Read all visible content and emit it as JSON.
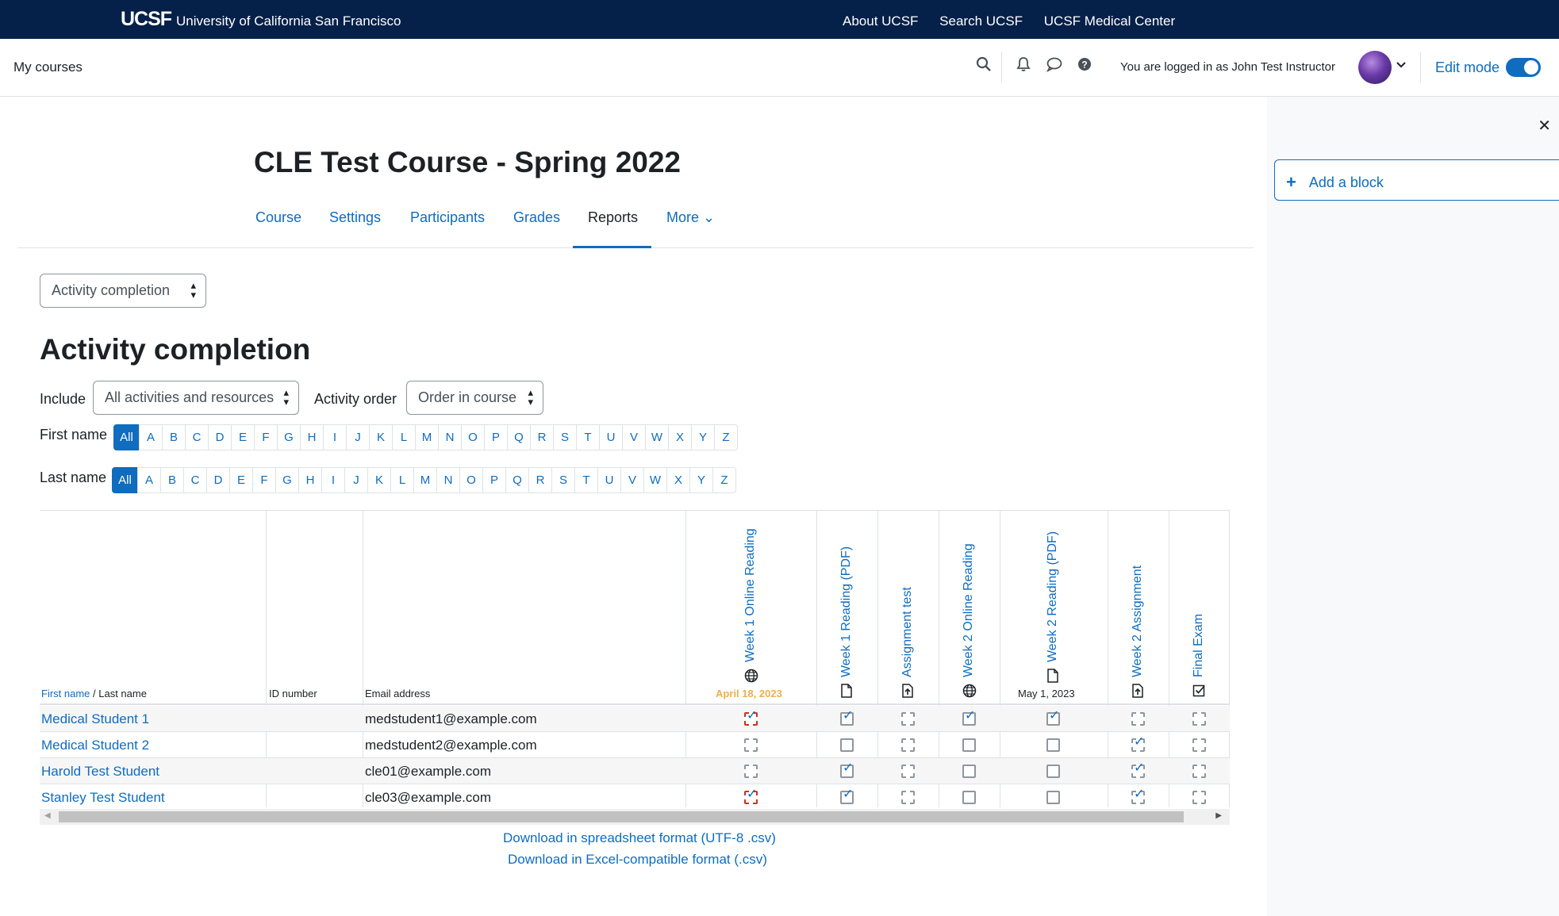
{
  "topbar": {
    "logo": "UCSF",
    "university": "University of California San Francisco",
    "links": [
      "About UCSF",
      "Search UCSF",
      "UCSF Medical Center"
    ]
  },
  "navbar": {
    "my_courses": "My courses",
    "logged_in": "You are logged in as John Test Instructor",
    "edit_mode": "Edit mode",
    "edit_mode_on": true
  },
  "drawer": {
    "add_block": "Add a block"
  },
  "course": {
    "title": "CLE Test Course - Spring 2022",
    "tabs": [
      {
        "label": "Course"
      },
      {
        "label": "Settings"
      },
      {
        "label": "Participants"
      },
      {
        "label": "Grades"
      },
      {
        "label": "Reports",
        "active": true
      },
      {
        "label": "More ⌄"
      }
    ]
  },
  "report_select": "Activity completion",
  "heading": "Activity completion",
  "filters": {
    "include_label": "Include",
    "include_value": "All activities and resources",
    "order_label": "Activity order",
    "order_value": "Order in course",
    "first_name_label": "First name",
    "last_name_label": "Last name",
    "letters": [
      "All",
      "A",
      "B",
      "C",
      "D",
      "E",
      "F",
      "G",
      "H",
      "I",
      "J",
      "K",
      "L",
      "M",
      "N",
      "O",
      "P",
      "Q",
      "R",
      "S",
      "T",
      "U",
      "V",
      "W",
      "X",
      "Y",
      "Z"
    ]
  },
  "table": {
    "col_firstname": "First name",
    "col_sep": " / ",
    "col_lastname": "Last name",
    "col_id": "ID number",
    "col_email": "Email address",
    "activities": [
      {
        "name": "Week 1 Online Reading",
        "icon": "globe-icon",
        "date": "April 18, 2023",
        "date_warn": true
      },
      {
        "name": "Week 1 Reading (PDF)",
        "icon": "file-icon",
        "date": ""
      },
      {
        "name": "Assignment test",
        "icon": "assignment-icon",
        "date": ""
      },
      {
        "name": "Week 2 Online Reading",
        "icon": "globe-icon",
        "date": ""
      },
      {
        "name": "Week 2 Reading (PDF)",
        "icon": "file-icon",
        "date": "May 1, 2023",
        "date_warn": false
      },
      {
        "name": "Week 2 Assignment",
        "icon": "assignment-icon",
        "date": ""
      },
      {
        "name": "Final Exam",
        "icon": "quiz-icon",
        "date": ""
      }
    ],
    "rows": [
      {
        "name": "Medical Student 1",
        "email": "medstudent1@example.com",
        "cells": [
          "checked-red",
          "checked",
          "empty-auto",
          "checked",
          "checked",
          "empty-auto",
          "empty-auto"
        ]
      },
      {
        "name": "Medical Student 2",
        "email": "medstudent2@example.com",
        "cells": [
          "empty-auto",
          "empty",
          "empty-auto",
          "empty",
          "empty",
          "checked-auto",
          "empty-auto"
        ]
      },
      {
        "name": "Harold Test Student",
        "email": "cle01@example.com",
        "cells": [
          "empty-auto",
          "checked",
          "empty-auto",
          "empty",
          "empty",
          "checked-auto",
          "empty-auto"
        ]
      },
      {
        "name": "Stanley Test Student",
        "email": "cle03@example.com",
        "cells": [
          "checked-red",
          "checked",
          "empty-auto",
          "empty",
          "empty",
          "checked-auto",
          "empty-auto"
        ]
      }
    ]
  },
  "downloads": {
    "csv": "Download in spreadsheet format (UTF-8 .csv)",
    "excel": "Download in Excel-compatible format (.csv)"
  },
  "colors": {
    "brand_navy": "#052049",
    "link_blue": "#0f6cbf",
    "warn_orange": "#f0ad4e",
    "overdue_red": "#ca3120"
  }
}
